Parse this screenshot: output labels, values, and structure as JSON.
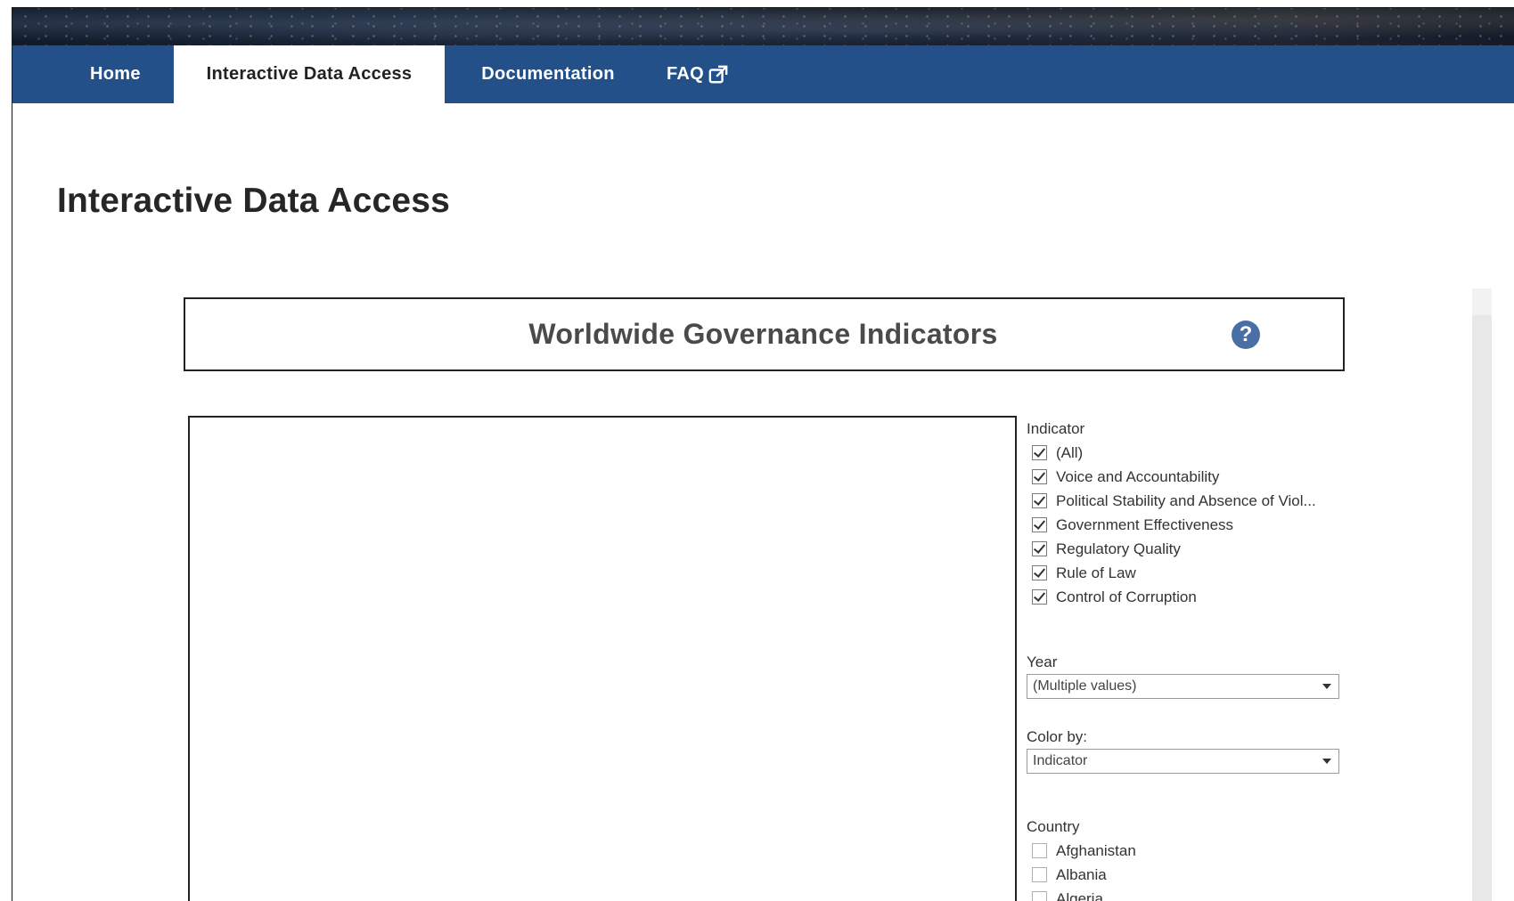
{
  "nav": {
    "items": [
      {
        "label": "Home"
      },
      {
        "label": "Interactive Data Access"
      },
      {
        "label": "Documentation"
      },
      {
        "label": "FAQ"
      }
    ]
  },
  "page": {
    "title": "Interactive Data Access"
  },
  "dashboard": {
    "title": "Worldwide Governance Indicators",
    "help_glyph": "?"
  },
  "filters": {
    "indicator": {
      "label": "Indicator",
      "options": [
        {
          "label": "(All)",
          "checked": true
        },
        {
          "label": "Voice and Accountability",
          "checked": true
        },
        {
          "label": "Political Stability and Absence of Viol...",
          "checked": true
        },
        {
          "label": "Government Effectiveness",
          "checked": true
        },
        {
          "label": "Regulatory Quality",
          "checked": true
        },
        {
          "label": "Rule of Law",
          "checked": true
        },
        {
          "label": "Control of Corruption",
          "checked": true
        }
      ]
    },
    "year": {
      "label": "Year",
      "value": "(Multiple values)"
    },
    "color_by": {
      "label": "Color by:",
      "value": "Indicator"
    },
    "country": {
      "label": "Country",
      "options": [
        {
          "label": "Afghanistan",
          "checked": false
        },
        {
          "label": "Albania",
          "checked": false
        },
        {
          "label": "Algeria",
          "checked": false
        }
      ]
    }
  },
  "colors": {
    "nav_background": "#235089",
    "help_icon": "#4a6fa5"
  },
  "icons": {
    "faq_external": "external-link-icon",
    "help": "question-circle-icon"
  }
}
